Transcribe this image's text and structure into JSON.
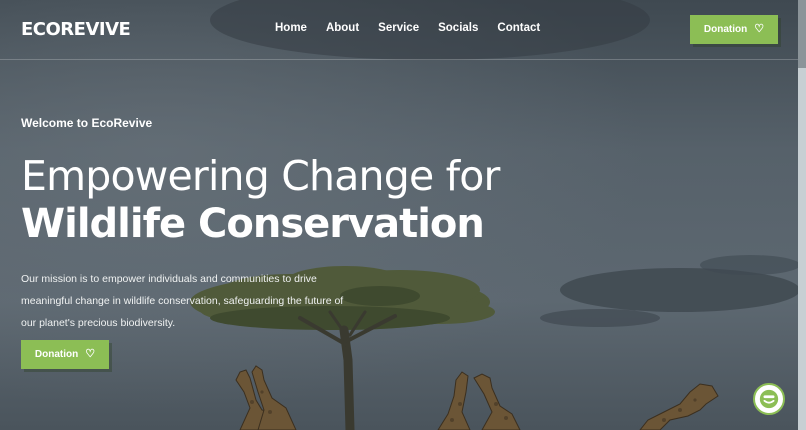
{
  "header": {
    "logo": "ECOREVIVE",
    "nav": [
      "Home",
      "About",
      "Service",
      "Socials",
      "Contact"
    ],
    "donation_button": "Donation"
  },
  "hero": {
    "eyebrow": "Welcome to EcoRevive",
    "headline_line1": "Empowering Change for",
    "headline_line2": "Wildlife Conservation",
    "description": "Our mission is to empower individuals and communities to drive meaningful change in wildlife conservation, safeguarding the future of our planet's precious biodiversity.",
    "donation_button": "Donation"
  },
  "icons": {
    "donation": "heart-icon",
    "chat": "chat-icon"
  },
  "colors": {
    "accent": "#8cbe55",
    "text": "#ffffff"
  }
}
